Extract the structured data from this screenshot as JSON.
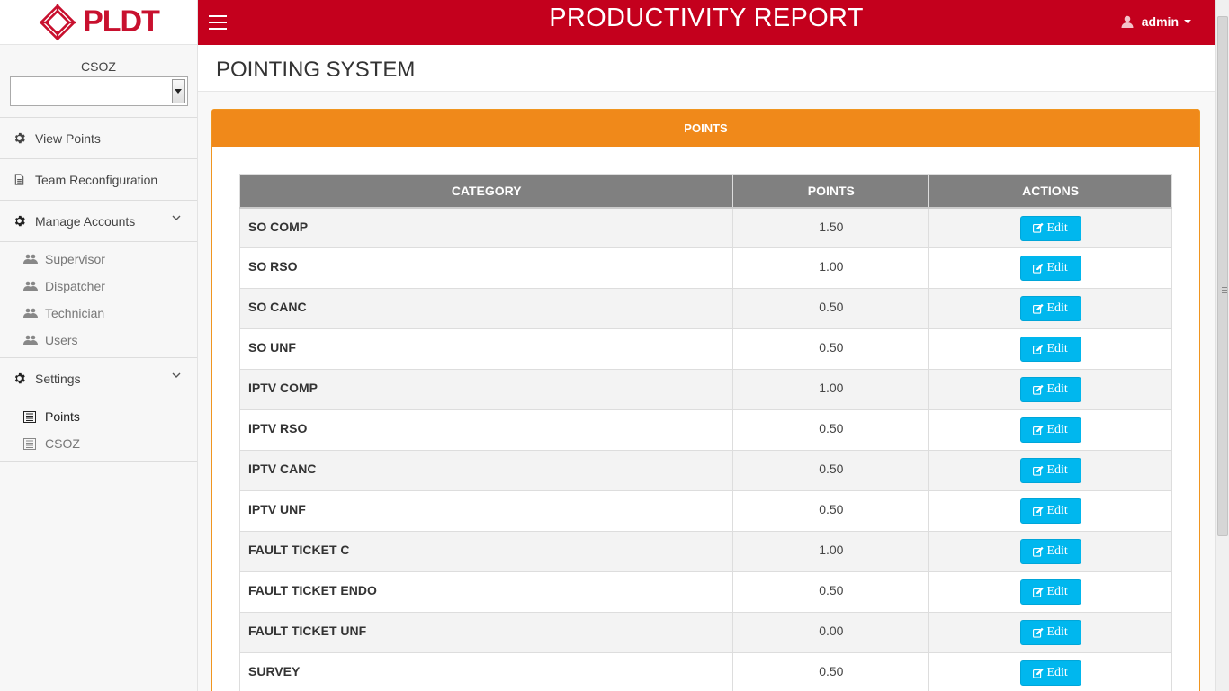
{
  "brand": {
    "logo_text": "PLDT",
    "color": "#c8102e"
  },
  "sidebar": {
    "csoz_label": "CSOZ",
    "csoz_value": "",
    "items": [
      {
        "label": "View Points",
        "icon": "gear-icon"
      },
      {
        "label": "Team Reconfiguration",
        "icon": "file-icon"
      },
      {
        "label": "Manage Accounts",
        "icon": "gear-icon"
      },
      {
        "label": "Settings",
        "icon": "gear-icon"
      }
    ],
    "manage_accounts_sub": [
      {
        "label": "Supervisor",
        "icon": "users-icon"
      },
      {
        "label": "Dispatcher",
        "icon": "users-icon"
      },
      {
        "label": "Technician",
        "icon": "users-icon"
      },
      {
        "label": "Users",
        "icon": "users-icon"
      }
    ],
    "settings_sub": [
      {
        "label": "Points",
        "icon": "list-icon",
        "active": true
      },
      {
        "label": "CSOZ",
        "icon": "list-icon",
        "active": false
      }
    ]
  },
  "header": {
    "title": "PRODUCTIVITY REPORT",
    "user": "admin",
    "bg_color": "#c4001d"
  },
  "page": {
    "title": "POINTING SYSTEM",
    "panel_title": "POINTS",
    "panel_color": "#f0891a"
  },
  "table": {
    "columns": [
      "CATEGORY",
      "POINTS",
      "ACTIONS"
    ],
    "edit_label": "Edit",
    "rows": [
      {
        "category": "SO COMP",
        "points": "1.50"
      },
      {
        "category": "SO RSO",
        "points": "1.00"
      },
      {
        "category": "SO CANC",
        "points": "0.50"
      },
      {
        "category": "SO UNF",
        "points": "0.50"
      },
      {
        "category": "IPTV COMP",
        "points": "1.00"
      },
      {
        "category": "IPTV RSO",
        "points": "0.50"
      },
      {
        "category": "IPTV CANC",
        "points": "0.50"
      },
      {
        "category": "IPTV UNF",
        "points": "0.50"
      },
      {
        "category": "FAULT TICKET C",
        "points": "1.00"
      },
      {
        "category": "FAULT TICKET ENDO",
        "points": "0.50"
      },
      {
        "category": "FAULT TICKET UNF",
        "points": "0.00"
      },
      {
        "category": "SURVEY",
        "points": "0.50"
      }
    ]
  }
}
